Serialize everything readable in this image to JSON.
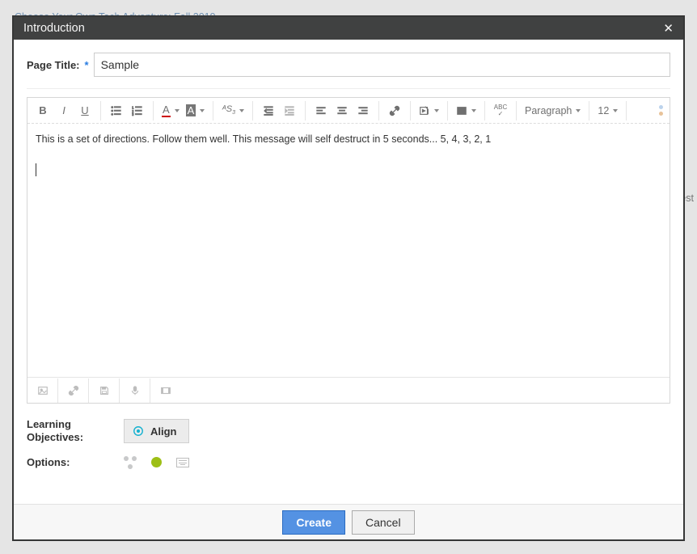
{
  "background": {
    "link": "Choose Your Own Tech Adventure: Fall 2019",
    "right_fragment": "uest"
  },
  "modal": {
    "title": "Introduction",
    "page_title_label": "Page Title:",
    "required_marker": "*",
    "page_title_value": "Sample",
    "toolbar": {
      "paragraph_label": "Paragraph",
      "fontsize_label": "12"
    },
    "body_text": "This is a set of directions. Follow them well. This message will self destruct in 5 seconds... 5, 4, 3, 2, 1",
    "learning_objectives_label": "Learning Objectives:",
    "align_label": "Align",
    "options_label": "Options:",
    "create_label": "Create",
    "cancel_label": "Cancel",
    "status_blue": "#bcd3ec",
    "status_orange": "#e8c39a",
    "target_color": "#17b2d0",
    "green_dot": "#9dbf16"
  }
}
